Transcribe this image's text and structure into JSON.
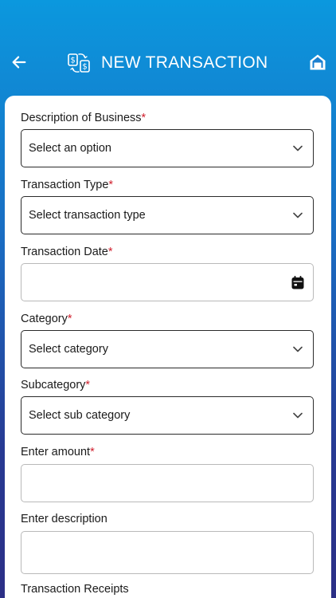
{
  "header": {
    "title": "NEW TRANSACTION",
    "icons": {
      "back": "arrow-left-icon",
      "title": "money-exchange-icon",
      "home": "home-icon"
    }
  },
  "form": {
    "business": {
      "label": "Description of Business",
      "required_mark": "*",
      "value": "Select an option"
    },
    "transaction_type": {
      "label": "Transaction Type",
      "required_mark": "*",
      "value": "Select transaction type"
    },
    "transaction_date": {
      "label": "Transaction Date",
      "required_mark": "*",
      "value": ""
    },
    "category": {
      "label": "Category",
      "required_mark": "*",
      "value": "Select category"
    },
    "subcategory": {
      "label": "Subcategory",
      "required_mark": "*",
      "value": "Select sub category"
    },
    "amount": {
      "label": "Enter amount",
      "required_mark": "*",
      "value": ""
    },
    "description": {
      "label": "Enter description",
      "value": ""
    },
    "receipts": {
      "label": "Transaction Receipts"
    }
  },
  "colors": {
    "required": "#d0202e",
    "gradient_top": "#0b98de",
    "gradient_bottom": "#2c2f86"
  }
}
